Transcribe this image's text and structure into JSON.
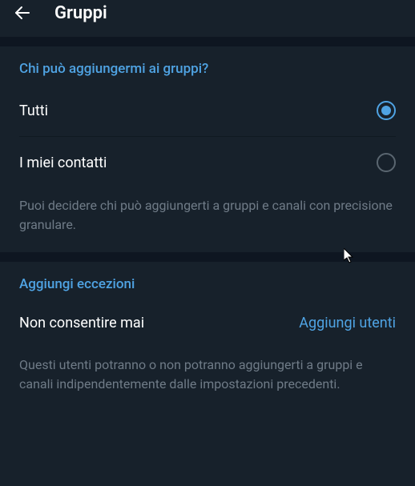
{
  "header": {
    "title": "Gruppi"
  },
  "who_can_add": {
    "title": "Chi può aggiungermi ai gruppi?",
    "options": [
      {
        "label": "Tutti",
        "selected": true
      },
      {
        "label": "I miei contatti",
        "selected": false
      }
    ],
    "hint": "Puoi decidere chi può aggiungerti a gruppi e canali con precisione granulare."
  },
  "exceptions": {
    "title": "Aggiungi eccezioni",
    "never_allow_label": "Non consentire mai",
    "add_users_label": "Aggiungi utenti",
    "hint": "Questi utenti potranno o non potranno aggiungerti a gruppi e canali indipendentemente dalle impostazioni precedenti."
  }
}
